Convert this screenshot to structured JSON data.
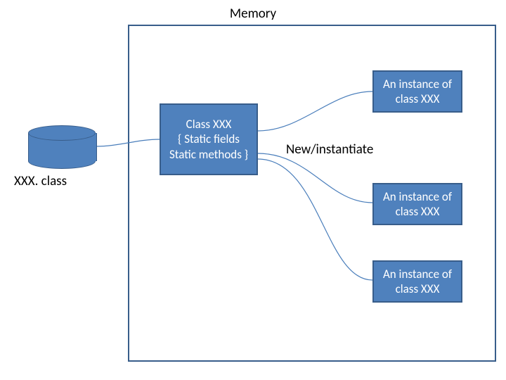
{
  "title": "Memory",
  "cylinder_label": "XXX. class",
  "class_box": {
    "line1": "Class XXX",
    "line2": "{ Static fields",
    "line3": "Static methods }"
  },
  "new_label": "New/instantiate",
  "instances": [
    "An instance of class XXX",
    "An instance of class XXX",
    "An instance of class XXX"
  ],
  "colors": {
    "box_fill": "#4f81bd",
    "box_border": "#385d8a",
    "connector": "#4a7ebb"
  }
}
